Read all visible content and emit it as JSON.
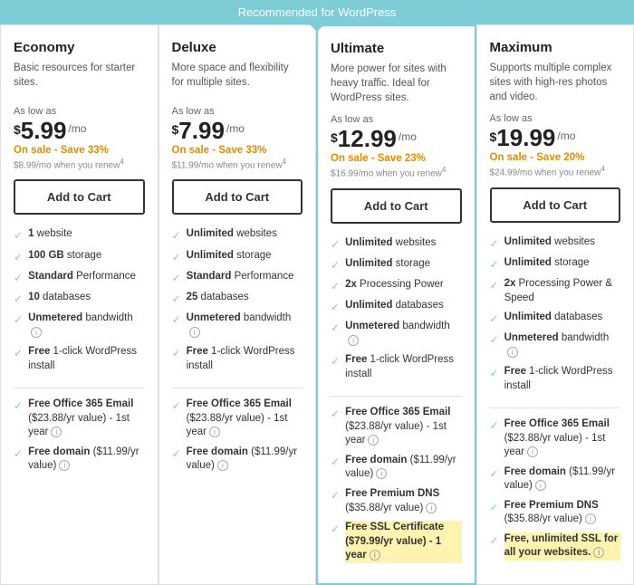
{
  "banner": {
    "text": "Recommended for WordPress"
  },
  "plans": [
    {
      "id": "economy",
      "name": "Economy",
      "desc": "Basic resources for starter sites.",
      "priceLabel": "As low as",
      "priceAmount": "$5.99",
      "priceMo": "/mo",
      "sale": "On sale - Save 33%",
      "renew": "$8.99/mo when you renew",
      "btnLabel": "Add to Cart",
      "highlighted": false,
      "features": [
        {
          "text": "1 website",
          "bold": "1",
          "info": false
        },
        {
          "text": "100 GB storage",
          "bold": "100 GB",
          "info": false
        },
        {
          "text": "Standard Performance",
          "bold": "Standard",
          "info": false
        },
        {
          "text": "10 databases",
          "bold": "10",
          "info": false
        },
        {
          "text": "Unmetered bandwidth",
          "bold": "Unmetered",
          "info": true
        },
        {
          "text": "Free 1-click WordPress install",
          "bold": "Free",
          "info": false
        }
      ],
      "extras": [
        {
          "text": "Free Office 365 Email ($23.88/yr value) - 1st year",
          "bold": "Free Office 365 Email",
          "info": true
        },
        {
          "text": "Free domain ($11.99/yr value)",
          "bold": "Free domain",
          "info": true
        }
      ]
    },
    {
      "id": "deluxe",
      "name": "Deluxe",
      "desc": "More space and flexibility for multiple sites.",
      "priceLabel": "As low as",
      "priceAmount": "$7.99",
      "priceMo": "/mo",
      "sale": "On sale - Save 33%",
      "renew": "$11.99/mo when you renew",
      "btnLabel": "Add to Cart",
      "highlighted": false,
      "features": [
        {
          "text": "Unlimited websites",
          "bold": "Unlimited",
          "info": false
        },
        {
          "text": "Unlimited storage",
          "bold": "Unlimited",
          "info": false
        },
        {
          "text": "Standard Performance",
          "bold": "Standard",
          "info": false
        },
        {
          "text": "25 databases",
          "bold": "25",
          "info": false
        },
        {
          "text": "Unmetered bandwidth",
          "bold": "Unmetered",
          "info": true
        },
        {
          "text": "Free 1-click WordPress install",
          "bold": "Free",
          "info": false
        }
      ],
      "extras": [
        {
          "text": "Free Office 365 Email ($23.88/yr value) - 1st year",
          "bold": "Free Office 365 Email",
          "info": true
        },
        {
          "text": "Free domain ($11.99/yr value)",
          "bold": "Free domain",
          "info": true
        }
      ]
    },
    {
      "id": "ultimate",
      "name": "Ultimate",
      "desc": "More power for sites with heavy traffic. Ideal for WordPress sites.",
      "priceLabel": "As low as",
      "priceAmount": "$12.99",
      "priceMo": "/mo",
      "sale": "On sale - Save 23%",
      "renew": "$16.99/mo when you renew",
      "btnLabel": "Add to Cart",
      "highlighted": true,
      "features": [
        {
          "text": "Unlimited websites",
          "bold": "Unlimited",
          "info": false
        },
        {
          "text": "Unlimited storage",
          "bold": "Unlimited",
          "info": false
        },
        {
          "text": "2x Processing Power",
          "bold": "2x",
          "info": false
        },
        {
          "text": "Unlimited databases",
          "bold": "Unlimited",
          "info": false
        },
        {
          "text": "Unmetered bandwidth",
          "bold": "Unmetered",
          "info": true
        },
        {
          "text": "Free 1-click WordPress install",
          "bold": "Free",
          "info": false
        }
      ],
      "extras": [
        {
          "text": "Free Office 365 Email ($23.88/yr value) - 1st year",
          "bold": "Free Office 365 Email",
          "info": true
        },
        {
          "text": "Free domain ($11.99/yr value)",
          "bold": "Free domain",
          "info": true
        },
        {
          "text": "Free Premium DNS ($35.88/yr value)",
          "bold": "Free Premium DNS",
          "info": true
        },
        {
          "text": "Free SSL Certificate ($79.99/yr value) - 1 year",
          "bold": "Free SSL Certificate",
          "info": true,
          "yellowHighlight": true
        }
      ]
    },
    {
      "id": "maximum",
      "name": "Maximum",
      "desc": "Supports multiple complex sites with high-res photos and video.",
      "priceLabel": "As low as",
      "priceAmount": "$19.99",
      "priceMo": "/mo",
      "sale": "On sale - Save 20%",
      "renew": "$24.99/mo when you renew",
      "btnLabel": "Add to Cart",
      "highlighted": false,
      "features": [
        {
          "text": "Unlimited websites",
          "bold": "Unlimited",
          "info": false
        },
        {
          "text": "Unlimited storage",
          "bold": "Unlimited",
          "info": false
        },
        {
          "text": "2x Processing Power & Speed",
          "bold": "2x",
          "info": false
        },
        {
          "text": "Unlimited databases",
          "bold": "Unlimited",
          "info": false
        },
        {
          "text": "Unmetered bandwidth",
          "bold": "Unmetered",
          "info": true
        },
        {
          "text": "Free 1-click WordPress install",
          "bold": "Free",
          "info": false
        }
      ],
      "extras": [
        {
          "text": "Free Office 365 Email ($23.88/yr value) - 1st year",
          "bold": "Free Office 365 Email",
          "info": true
        },
        {
          "text": "Free domain ($11.99/yr value)",
          "bold": "Free domain",
          "info": true
        },
        {
          "text": "Free Premium DNS ($35.88/yr value)",
          "bold": "Free Premium DNS",
          "info": true
        },
        {
          "text": "Free, unlimited SSL for all your websites.",
          "bold": "Free, unlimited SSL for all your websites.",
          "info": true,
          "yellowHighlight": true
        }
      ]
    }
  ]
}
